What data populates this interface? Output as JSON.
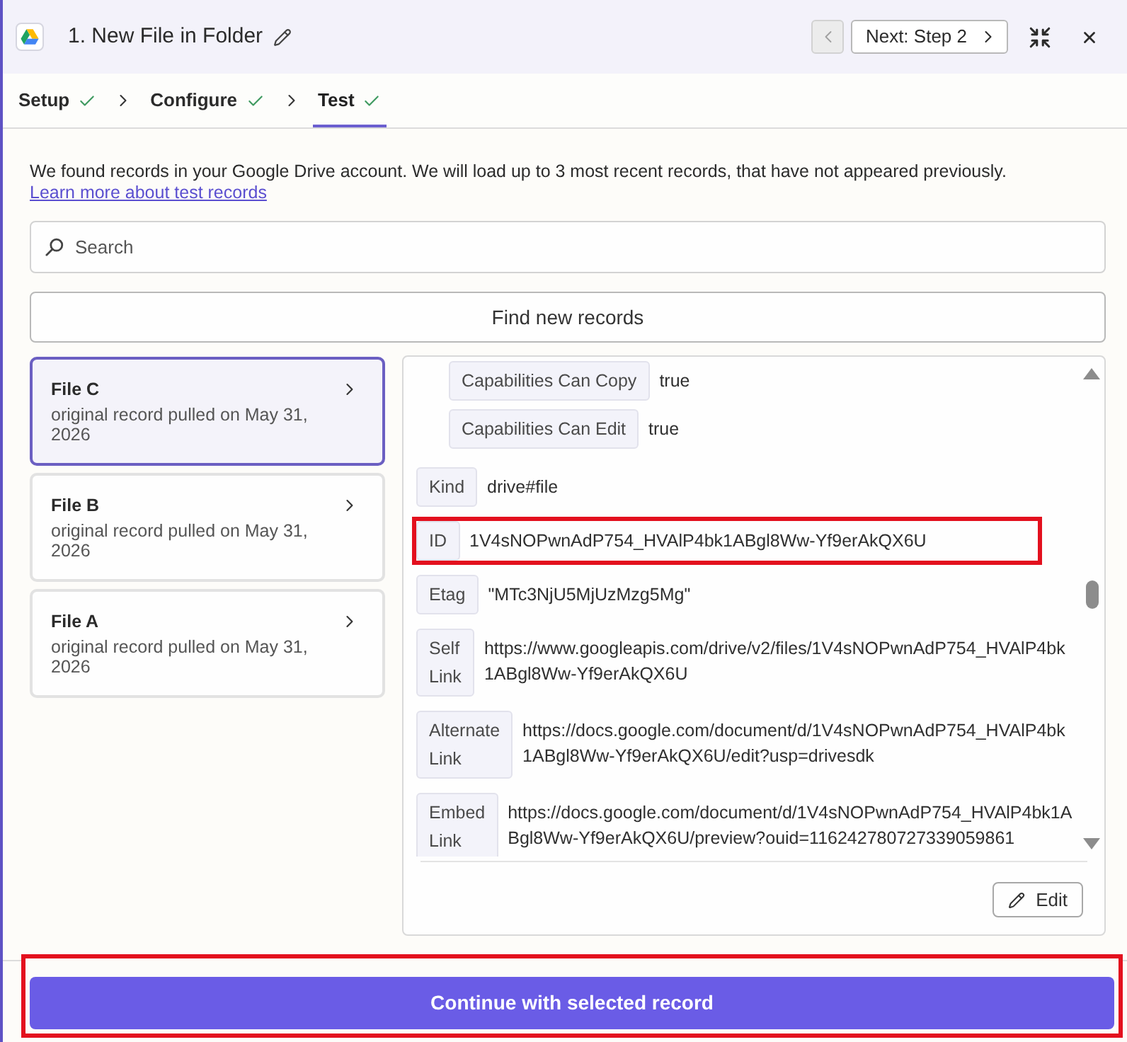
{
  "header": {
    "title": "1. New File in Folder",
    "previous_button": {
      "disabled": true
    },
    "next_button": {
      "label": "Next: Step 2"
    }
  },
  "steps": [
    {
      "label": "Setup",
      "done": true,
      "selected": false
    },
    {
      "label": "Configure",
      "done": true,
      "selected": false
    },
    {
      "label": "Test",
      "done": true,
      "selected": true
    }
  ],
  "intro": {
    "text": "We found records in your Google Drive account. We will load up to 3 most recent records, that have not appeared previously.",
    "link": "Learn more about test records"
  },
  "search": {
    "placeholder": "Search"
  },
  "find_button": "Find new records",
  "records": [
    {
      "title": "File C",
      "subtitle": "original record pulled on May 31, 2026",
      "selected": true
    },
    {
      "title": "File B",
      "subtitle": "original record pulled on May 31, 2026",
      "selected": false
    },
    {
      "title": "File A",
      "subtitle": "original record pulled on May 31, 2026",
      "selected": false
    }
  ],
  "fields": [
    {
      "kind": "group",
      "highlighted": false,
      "children": [
        {
          "kind": "field",
          "label": "Capabilities Can Copy",
          "value": "true",
          "highlighted": false
        },
        {
          "kind": "field",
          "label": "Capabilities Can Edit",
          "value": "true",
          "highlighted": false
        }
      ]
    },
    {
      "kind": "field",
      "label": "Kind",
      "value": "drive#file",
      "highlighted": false
    },
    {
      "kind": "field",
      "label": "ID",
      "value": "1V4sNOPwnAdP754_HVAlP4bk1ABgl8Ww-Yf9erAkQX6U",
      "highlighted": true
    },
    {
      "kind": "field",
      "label": "Etag",
      "value": "\"MTc3NjU5MjUzMzg5Mg\"",
      "highlighted": false
    },
    {
      "kind": "field",
      "label": "Self Link",
      "value": "https://www.googleapis.com/drive/v2/files/1V4sNOPwnAdP754_HVAlP4bk1ABgl8Ww-Yf9erAkQX6U",
      "highlighted": false
    },
    {
      "kind": "field",
      "label": "Alternate Link",
      "value": "https://docs.google.com/document/d/1V4sNOPwnAdP754_HVAlP4bk1ABgl8Ww-Yf9erAkQX6U/edit?usp=drivesdk",
      "highlighted": false
    },
    {
      "kind": "field",
      "label": "Embed Link",
      "value": "https://docs.google.com/document/d/1V4sNOPwnAdP754_HVAlP4bk1ABgl8Ww-Yf9erAkQX6U/preview?ouid=116242780727339059861",
      "highlighted": false
    }
  ],
  "edit_button": "Edit",
  "continue_button": {
    "label": "Continue with selected record",
    "highlighted": true
  }
}
